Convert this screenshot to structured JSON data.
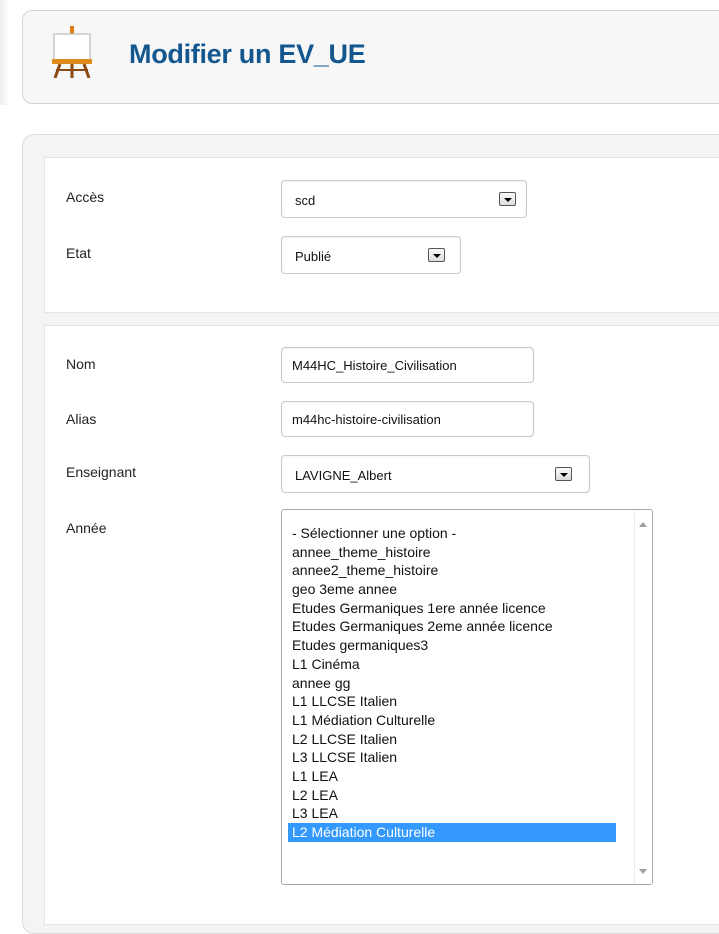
{
  "header": {
    "title": "Modifier un EV_UE",
    "icon": "easel-icon"
  },
  "form": {
    "acces": {
      "label": "Accès",
      "value": "scd"
    },
    "etat": {
      "label": "Etat",
      "value": "Publié"
    },
    "nom": {
      "label": "Nom",
      "value": "M44HC_Histoire_Civilisation"
    },
    "alias": {
      "label": "Alias",
      "value": "m44hc-histoire-civilisation"
    },
    "enseignant": {
      "label": "Enseignant",
      "value": "LAVIGNE_Albert"
    },
    "annee": {
      "label": "Année",
      "options": [
        "- Sélectionner une option -",
        "annee_theme_histoire",
        "annee2_theme_histoire",
        "geo 3eme annee",
        "Etudes Germaniques 1ere année licence",
        "Etudes Germaniques 2eme année licence",
        "Etudes germaniques3",
        "L1 Cinéma",
        "annee gg",
        "L1 LLCSE Italien",
        "L1 Médiation Culturelle",
        "L2 LLCSE Italien",
        "L3 LLCSE Italien",
        "L1 LEA",
        "L2 LEA",
        "L3 LEA",
        "L2 Médiation Culturelle"
      ],
      "selected": "L2 Médiation Culturelle"
    }
  },
  "colors": {
    "title": "#14578f",
    "selection": "#3399ff"
  }
}
